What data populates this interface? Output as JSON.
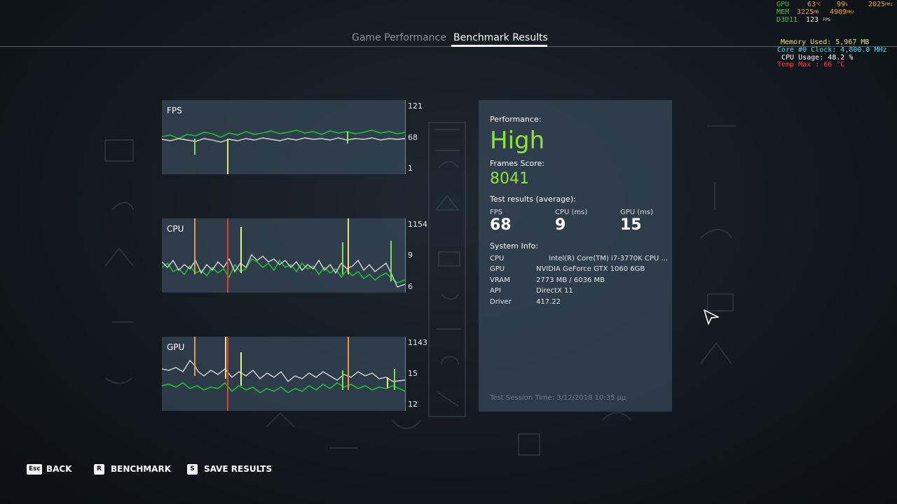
{
  "tabs": {
    "game_performance": "Game Performance",
    "benchmark_results": "Benchmark Results"
  },
  "osd": {
    "gpu_label": "GPU",
    "gpu_temp": "63",
    "gpu_temp_unit": "°C",
    "gpu_load": "99",
    "gpu_load_unit": "%",
    "gpu_clock": "2025",
    "gpu_clock_unit": "MHz",
    "mem_label": "MEM",
    "mem_used": "3225",
    "mem_used_unit": "MB",
    "mem_clock": "4909",
    "mem_clock_unit": "MHz",
    "api_label": "D3D11",
    "fps": "123",
    "fps_unit": "FPS",
    "memory_used": "Memory Used: 5,967 MB",
    "core_clock": "Core #0 Clock: 4,800.0 MHz",
    "cpu_usage": "CPU Usage: 48.2 %",
    "temp_max": "Temp  Max : 66 °C"
  },
  "graphs": [
    {
      "title": "FPS",
      "y_top": "121",
      "y_mid": "68",
      "y_bottom": "1"
    },
    {
      "title": "CPU",
      "y_top": "1154",
      "y_mid": "9",
      "y_bottom": "6"
    },
    {
      "title": "GPU",
      "y_top": "1143",
      "y_mid": "15",
      "y_bottom": "12"
    }
  ],
  "results": {
    "performance_label": "Performance:",
    "performance_value": "High",
    "frames_score_label": "Frames Score:",
    "frames_score_value": "8041",
    "test_results_label": "Test results (average):",
    "metrics": [
      {
        "label": "FPS",
        "value": "68"
      },
      {
        "label": "CPU (ms)",
        "value": "9"
      },
      {
        "label": "GPU (ms)",
        "value": "15"
      }
    ],
    "system_info_label": "System Info:",
    "system_info": [
      {
        "key": "CPU",
        "value": "Intel(R) Core(TM) i7-3770K CPU ..."
      },
      {
        "key": "GPU",
        "value": "NVIDIA GeForce GTX 1060 6GB"
      },
      {
        "key": "VRAM",
        "value": "2773 MB / 6036 MB"
      },
      {
        "key": "API",
        "value": "DirectX 11"
      },
      {
        "key": "Driver",
        "value": "417.22"
      }
    ],
    "session_time": "Test Session Time: 3/12/2018 10:35 μμ"
  },
  "footer": {
    "back_key": "Esc",
    "back_label": "BACK",
    "benchmark_key": "R",
    "benchmark_label": "BENCHMARK",
    "save_key": "S",
    "save_label": "SAVE RESULTS"
  },
  "colors": {
    "accent_green": "#8fe43b",
    "line_green": "#1fbf2e",
    "line_white": "#d8d8d8",
    "spike_yellow": "#e8e070",
    "spike_red": "#e04030",
    "panel_bg": "#37485a"
  }
}
